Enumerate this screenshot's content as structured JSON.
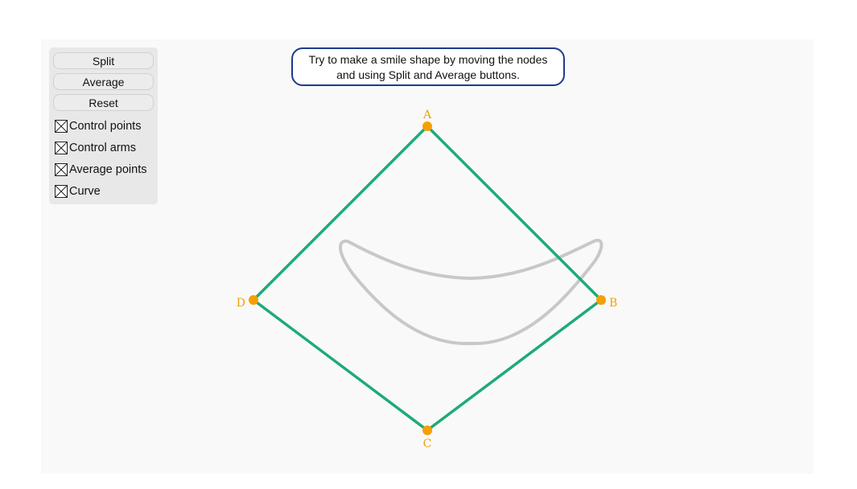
{
  "toolbar": {
    "split_label": "Split",
    "average_label": "Average",
    "reset_label": "Reset"
  },
  "checkboxes": [
    {
      "label": "Control points",
      "checked": true
    },
    {
      "label": "Control arms",
      "checked": true
    },
    {
      "label": "Average points",
      "checked": true
    },
    {
      "label": "Curve",
      "checked": true
    }
  ],
  "instruction": {
    "line1": "Try to make a smile shape by moving the nodes",
    "line2": "and using Split and Average buttons."
  },
  "nodes": [
    {
      "label": "A"
    },
    {
      "label": "B"
    },
    {
      "label": "C"
    },
    {
      "label": "D"
    }
  ],
  "colors": {
    "arm": "#1faa78",
    "node": "#f5a000",
    "curve": "#c8c8c8",
    "instruction_border": "#1e3a8a",
    "panel": "#e8e8e8",
    "canvas": "#f9f9f9"
  }
}
